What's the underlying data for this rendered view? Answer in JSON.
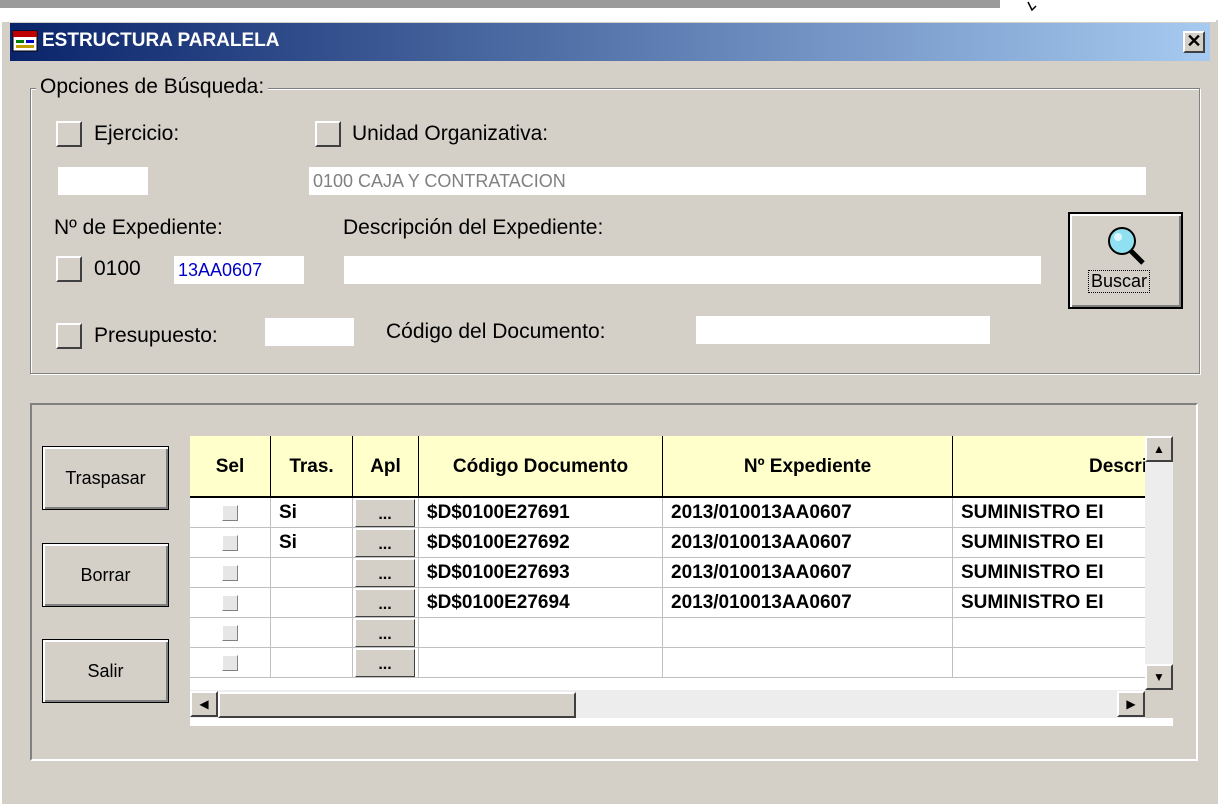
{
  "window": {
    "title": "ESTRUCTURA PARALELA",
    "close_label": "✕"
  },
  "search": {
    "legend": "Opciones de Búsqueda:",
    "ejercicio_label": "Ejercicio:",
    "ejercicio_value": "",
    "unidad_label": "Unidad Organizativa:",
    "unidad_value": "0100  CAJA Y CONTRATACION",
    "expediente_label": "Nº de Expediente:",
    "expediente_prefix": "0100",
    "expediente_value": "13AA0607",
    "descripcion_label": "Descripción del Expediente:",
    "descripcion_value": "",
    "presupuesto_label": "Presupuesto:",
    "presupuesto_value": "",
    "codigo_label": "Código del Documento:",
    "codigo_value": "",
    "buscar_label": "Buscar"
  },
  "actions": {
    "traspasar": "Traspasar",
    "borrar": "Borrar",
    "salir": "Salir"
  },
  "grid": {
    "columns": [
      "Sel",
      "Tras.",
      "Apl",
      "Código Documento",
      "Nº Expediente",
      "Descrip"
    ],
    "dots": "...",
    "rows": [
      {
        "tras": "Si",
        "codigo": "$D$0100E27691",
        "expediente": "2013/010013AA0607",
        "descripcion": "SUMINISTRO EI"
      },
      {
        "tras": "Si",
        "codigo": "$D$0100E27692",
        "expediente": "2013/010013AA0607",
        "descripcion": "SUMINISTRO EI"
      },
      {
        "tras": "",
        "codigo": "$D$0100E27693",
        "expediente": "2013/010013AA0607",
        "descripcion": "SUMINISTRO EI"
      },
      {
        "tras": "",
        "codigo": "$D$0100E27694",
        "expediente": "2013/010013AA0607",
        "descripcion": "SUMINISTRO EI"
      },
      {
        "tras": "",
        "codigo": "",
        "expediente": "",
        "descripcion": ""
      },
      {
        "tras": "",
        "codigo": "",
        "expediente": "",
        "descripcion": ""
      }
    ]
  },
  "colors": {
    "title_start": "#0a246a",
    "title_end": "#a6caf0",
    "header_bg": "#ffffcc",
    "face": "#d4d0c8"
  }
}
